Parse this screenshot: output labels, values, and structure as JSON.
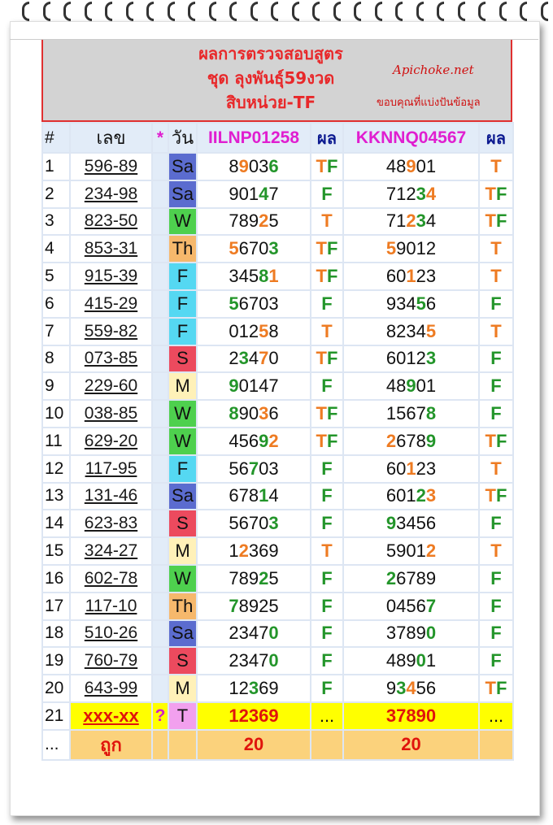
{
  "header": {
    "title_lines": [
      "ผลการตรวจสอบสูตร",
      "ชุด ลุงพันธุ์59งวด",
      "สิบหน่วย-TF"
    ],
    "watermark_name": "Apichoke.net",
    "watermark_thanks": "ขอบคุณที่แบ่งปันข้อมูล"
  },
  "columns": {
    "idx": "#",
    "num": "เลข",
    "star": "*",
    "day": "วัน",
    "f1": "IILNP01258",
    "r1": "ผล",
    "f2": "KKNNQ04567",
    "r2": "ผล"
  },
  "day_colors": {
    "Sa": "#5b6ccf",
    "W": "#4ed04e",
    "Th": "#f6b86c",
    "F": "#55d8f2",
    "S": "#ec4a5e",
    "M": "#fff1b8",
    "T": "#f2a0ee"
  },
  "rows": [
    {
      "i": "1",
      "n": "596-89",
      "d": "Sa",
      "a": "89036",
      "ad": [
        [
          1,
          "r"
        ],
        [
          4,
          "g"
        ]
      ],
      "ar": "TF",
      "b": "48901",
      "bd": [
        [
          2,
          "r"
        ]
      ],
      "br": "T"
    },
    {
      "i": "2",
      "n": "234-98",
      "d": "Sa",
      "a": "90147",
      "ad": [
        [
          3,
          "g"
        ]
      ],
      "ar": "F",
      "b": "71234",
      "bd": [
        [
          3,
          "g"
        ],
        [
          4,
          "r"
        ]
      ],
      "br": "TF"
    },
    {
      "i": "3",
      "n": "823-50",
      "d": "W",
      "a": "78925",
      "ad": [
        [
          3,
          "r"
        ]
      ],
      "ar": "T",
      "b": "71234",
      "bd": [
        [
          2,
          "r"
        ],
        [
          3,
          "g"
        ]
      ],
      "br": "TF"
    },
    {
      "i": "4",
      "n": "853-31",
      "d": "Th",
      "a": "56703",
      "ad": [
        [
          0,
          "r"
        ],
        [
          4,
          "g"
        ]
      ],
      "ar": "TF",
      "b": "59012",
      "bd": [
        [
          0,
          "r"
        ]
      ],
      "br": "T"
    },
    {
      "i": "5",
      "n": "915-39",
      "d": "F",
      "a": "34581",
      "ad": [
        [
          3,
          "g"
        ],
        [
          4,
          "r"
        ]
      ],
      "ar": "TF",
      "b": "60123",
      "bd": [
        [
          2,
          "r"
        ]
      ],
      "br": "T"
    },
    {
      "i": "6",
      "n": "415-29",
      "d": "F",
      "a": "56703",
      "ad": [
        [
          0,
          "g"
        ]
      ],
      "ar": "F",
      "b": "93456",
      "bd": [
        [
          3,
          "g"
        ]
      ],
      "br": "F"
    },
    {
      "i": "7",
      "n": "559-82",
      "d": "F",
      "a": "01258",
      "ad": [
        [
          3,
          "r"
        ]
      ],
      "ar": "T",
      "b": "82345",
      "bd": [
        [
          4,
          "r"
        ]
      ],
      "br": "T"
    },
    {
      "i": "8",
      "n": "073-85",
      "d": "S",
      "a": "23470",
      "ad": [
        [
          1,
          "g"
        ],
        [
          3,
          "r"
        ]
      ],
      "ar": "TF",
      "b": "60123",
      "bd": [
        [
          4,
          "g"
        ]
      ],
      "br": "F"
    },
    {
      "i": "9",
      "n": "229-60",
      "d": "M",
      "a": "90147",
      "ad": [
        [
          0,
          "g"
        ]
      ],
      "ar": "F",
      "b": "48901",
      "bd": [
        [
          2,
          "g"
        ]
      ],
      "br": "F"
    },
    {
      "i": "10",
      "n": "038-85",
      "d": "W",
      "a": "89036",
      "ad": [
        [
          0,
          "g"
        ],
        [
          3,
          "r"
        ]
      ],
      "ar": "TF",
      "b": "15678",
      "bd": [
        [
          4,
          "g"
        ]
      ],
      "br": "F"
    },
    {
      "i": "11",
      "n": "629-20",
      "d": "W",
      "a": "45692",
      "ad": [
        [
          3,
          "g"
        ],
        [
          4,
          "r"
        ]
      ],
      "ar": "TF",
      "b": "26789",
      "bd": [
        [
          0,
          "r"
        ],
        [
          4,
          "g"
        ]
      ],
      "br": "TF"
    },
    {
      "i": "12",
      "n": "117-95",
      "d": "F",
      "a": "56703",
      "ad": [
        [
          2,
          "g"
        ]
      ],
      "ar": "F",
      "b": "60123",
      "bd": [
        [
          2,
          "r"
        ]
      ],
      "br": "T"
    },
    {
      "i": "13",
      "n": "131-46",
      "d": "Sa",
      "a": "67814",
      "ad": [
        [
          3,
          "g"
        ]
      ],
      "ar": "F",
      "b": "60123",
      "bd": [
        [
          3,
          "g"
        ],
        [
          4,
          "r"
        ]
      ],
      "br": "TF"
    },
    {
      "i": "14",
      "n": "623-83",
      "d": "S",
      "a": "56703",
      "ad": [
        [
          4,
          "g"
        ]
      ],
      "ar": "F",
      "b": "93456",
      "bd": [
        [
          0,
          "g"
        ]
      ],
      "br": "F"
    },
    {
      "i": "15",
      "n": "324-27",
      "d": "M",
      "a": "12369",
      "ad": [
        [
          1,
          "r"
        ]
      ],
      "ar": "T",
      "b": "59012",
      "bd": [
        [
          4,
          "r"
        ]
      ],
      "br": "T"
    },
    {
      "i": "16",
      "n": "602-78",
      "d": "W",
      "a": "78925",
      "ad": [
        [
          3,
          "g"
        ]
      ],
      "ar": "F",
      "b": "26789",
      "bd": [
        [
          0,
          "g"
        ]
      ],
      "br": "F"
    },
    {
      "i": "17",
      "n": "117-10",
      "d": "Th",
      "a": "78925",
      "ad": [
        [
          0,
          "g"
        ]
      ],
      "ar": "F",
      "b": "04567",
      "bd": [
        [
          4,
          "g"
        ]
      ],
      "br": "F"
    },
    {
      "i": "18",
      "n": "510-26",
      "d": "Sa",
      "a": "23470",
      "ad": [
        [
          4,
          "g"
        ]
      ],
      "ar": "F",
      "b": "37890",
      "bd": [
        [
          4,
          "g"
        ]
      ],
      "br": "F"
    },
    {
      "i": "19",
      "n": "760-79",
      "d": "S",
      "a": "23470",
      "ad": [
        [
          4,
          "g"
        ]
      ],
      "ar": "F",
      "b": "48901",
      "bd": [
        [
          3,
          "g"
        ]
      ],
      "br": "F"
    },
    {
      "i": "20",
      "n": "643-99",
      "d": "M",
      "a": "12369",
      "ad": [
        [
          2,
          "g"
        ]
      ],
      "ar": "F",
      "b": "93456",
      "bd": [
        [
          1,
          "g"
        ],
        [
          2,
          "r"
        ]
      ],
      "br": "TF"
    }
  ],
  "prediction": {
    "i": "21",
    "n": "xxx-xx",
    "q": "?",
    "d": "T",
    "a": "12369",
    "ar": "...",
    "b": "37890",
    "br": "..."
  },
  "totals": {
    "i": "...",
    "label": "ถูก",
    "a": "20",
    "b": "20"
  }
}
